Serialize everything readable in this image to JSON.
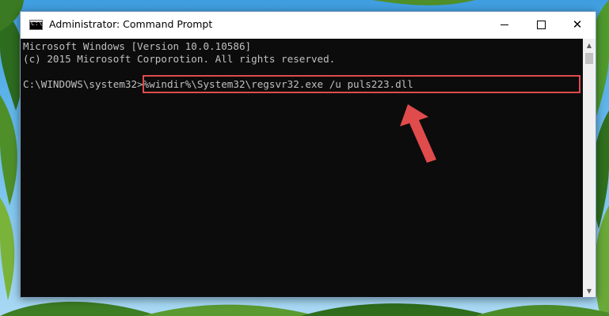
{
  "window": {
    "title": "Administrator: Command Prompt",
    "icon": "cmd-icon"
  },
  "controls": {
    "minimize_icon": "minimize-icon",
    "maximize_icon": "maximize-icon",
    "close_icon": "close-icon",
    "close_glyph": "✕"
  },
  "console": {
    "line1": "Microsoft Windows [Version 10.0.10586]",
    "line2": "(c) 2015 Microsoft Corporotion. All rights reserved.",
    "prompt": "C:\\WINDOWS\\system32>",
    "command": "%windir%\\System32\\regsvr32.exe /u puls223.dll"
  },
  "scrollbar": {
    "up_glyph": "▲",
    "down_glyph": "▼"
  },
  "colors": {
    "console_background": "#0c0c0c",
    "console_text": "#c0c0c0",
    "highlight": "#e04b4b",
    "arrow": "#e04b4b"
  }
}
